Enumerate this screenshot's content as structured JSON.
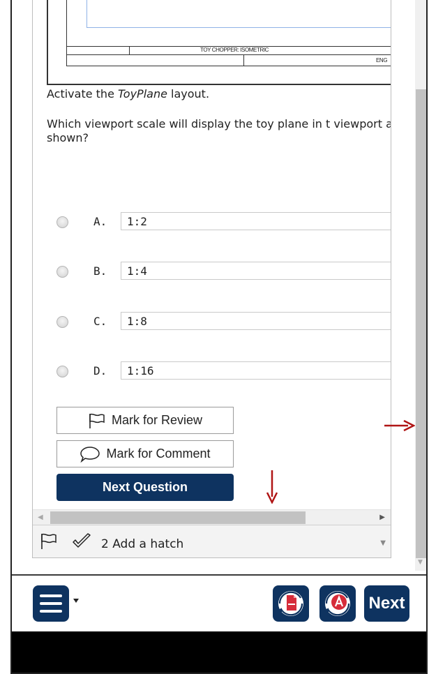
{
  "drawing": {
    "title_block_text": "TOY CHOPPER: ISOMETRIC",
    "title_block_text2": "ENG"
  },
  "question": {
    "instruction_prefix": "Activate the ",
    "instruction_italic": "ToyPlane",
    "instruction_suffix": " layout.",
    "text": "Which viewport scale will display the toy plane in t viewport as shown?"
  },
  "choices": [
    {
      "letter": "A.",
      "value": "1:2"
    },
    {
      "letter": "B.",
      "value": "1:4"
    },
    {
      "letter": "C.",
      "value": "1:8"
    },
    {
      "letter": "D.",
      "value": "1:16"
    }
  ],
  "buttons": {
    "mark_review": "Mark for Review",
    "mark_comment": "Mark for Comment",
    "next_question": "Next Question"
  },
  "status_bar": {
    "label": "2 Add a hatch"
  },
  "toolbar": {
    "next_label": "Next"
  },
  "colors": {
    "navy": "#0e3360",
    "annotation_red": "#b01515",
    "tool_red": "#d62c3a"
  },
  "icons": {
    "flag": "flag-icon",
    "comment": "speech-bubble-icon",
    "check": "checkmark-icon",
    "menu": "hamburger-menu-icon"
  }
}
